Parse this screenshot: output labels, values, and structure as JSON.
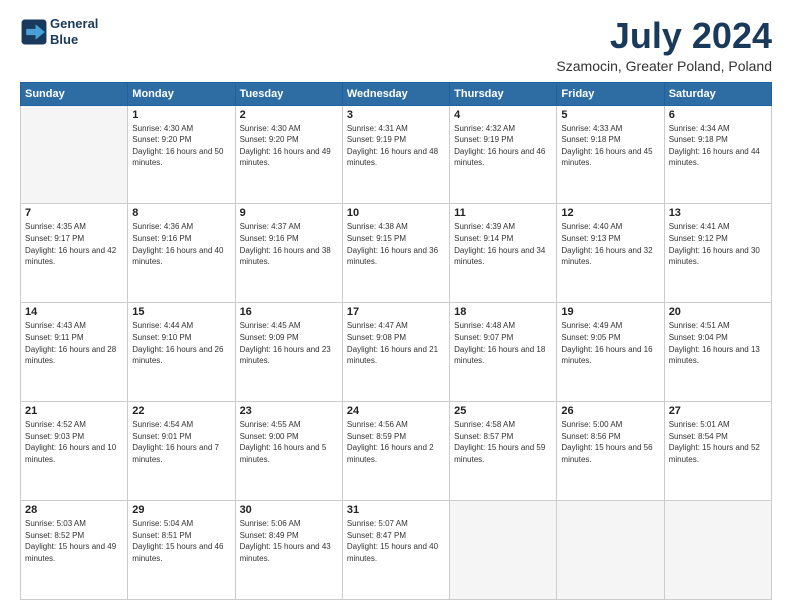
{
  "header": {
    "logo_line1": "General",
    "logo_line2": "Blue",
    "title": "July 2024",
    "location": "Szamocin, Greater Poland, Poland"
  },
  "weekdays": [
    "Sunday",
    "Monday",
    "Tuesday",
    "Wednesday",
    "Thursday",
    "Friday",
    "Saturday"
  ],
  "weeks": [
    [
      {
        "day": "",
        "empty": true
      },
      {
        "day": "1",
        "sunrise": "4:30 AM",
        "sunset": "9:20 PM",
        "daylight": "16 hours and 50 minutes."
      },
      {
        "day": "2",
        "sunrise": "4:30 AM",
        "sunset": "9:20 PM",
        "daylight": "16 hours and 49 minutes."
      },
      {
        "day": "3",
        "sunrise": "4:31 AM",
        "sunset": "9:19 PM",
        "daylight": "16 hours and 48 minutes."
      },
      {
        "day": "4",
        "sunrise": "4:32 AM",
        "sunset": "9:19 PM",
        "daylight": "16 hours and 46 minutes."
      },
      {
        "day": "5",
        "sunrise": "4:33 AM",
        "sunset": "9:18 PM",
        "daylight": "16 hours and 45 minutes."
      },
      {
        "day": "6",
        "sunrise": "4:34 AM",
        "sunset": "9:18 PM",
        "daylight": "16 hours and 44 minutes."
      }
    ],
    [
      {
        "day": "7",
        "sunrise": "4:35 AM",
        "sunset": "9:17 PM",
        "daylight": "16 hours and 42 minutes."
      },
      {
        "day": "8",
        "sunrise": "4:36 AM",
        "sunset": "9:16 PM",
        "daylight": "16 hours and 40 minutes."
      },
      {
        "day": "9",
        "sunrise": "4:37 AM",
        "sunset": "9:16 PM",
        "daylight": "16 hours and 38 minutes."
      },
      {
        "day": "10",
        "sunrise": "4:38 AM",
        "sunset": "9:15 PM",
        "daylight": "16 hours and 36 minutes."
      },
      {
        "day": "11",
        "sunrise": "4:39 AM",
        "sunset": "9:14 PM",
        "daylight": "16 hours and 34 minutes."
      },
      {
        "day": "12",
        "sunrise": "4:40 AM",
        "sunset": "9:13 PM",
        "daylight": "16 hours and 32 minutes."
      },
      {
        "day": "13",
        "sunrise": "4:41 AM",
        "sunset": "9:12 PM",
        "daylight": "16 hours and 30 minutes."
      }
    ],
    [
      {
        "day": "14",
        "sunrise": "4:43 AM",
        "sunset": "9:11 PM",
        "daylight": "16 hours and 28 minutes."
      },
      {
        "day": "15",
        "sunrise": "4:44 AM",
        "sunset": "9:10 PM",
        "daylight": "16 hours and 26 minutes."
      },
      {
        "day": "16",
        "sunrise": "4:45 AM",
        "sunset": "9:09 PM",
        "daylight": "16 hours and 23 minutes."
      },
      {
        "day": "17",
        "sunrise": "4:47 AM",
        "sunset": "9:08 PM",
        "daylight": "16 hours and 21 minutes."
      },
      {
        "day": "18",
        "sunrise": "4:48 AM",
        "sunset": "9:07 PM",
        "daylight": "16 hours and 18 minutes."
      },
      {
        "day": "19",
        "sunrise": "4:49 AM",
        "sunset": "9:05 PM",
        "daylight": "16 hours and 16 minutes."
      },
      {
        "day": "20",
        "sunrise": "4:51 AM",
        "sunset": "9:04 PM",
        "daylight": "16 hours and 13 minutes."
      }
    ],
    [
      {
        "day": "21",
        "sunrise": "4:52 AM",
        "sunset": "9:03 PM",
        "daylight": "16 hours and 10 minutes."
      },
      {
        "day": "22",
        "sunrise": "4:54 AM",
        "sunset": "9:01 PM",
        "daylight": "16 hours and 7 minutes."
      },
      {
        "day": "23",
        "sunrise": "4:55 AM",
        "sunset": "9:00 PM",
        "daylight": "16 hours and 5 minutes."
      },
      {
        "day": "24",
        "sunrise": "4:56 AM",
        "sunset": "8:59 PM",
        "daylight": "16 hours and 2 minutes."
      },
      {
        "day": "25",
        "sunrise": "4:58 AM",
        "sunset": "8:57 PM",
        "daylight": "15 hours and 59 minutes."
      },
      {
        "day": "26",
        "sunrise": "5:00 AM",
        "sunset": "8:56 PM",
        "daylight": "15 hours and 56 minutes."
      },
      {
        "day": "27",
        "sunrise": "5:01 AM",
        "sunset": "8:54 PM",
        "daylight": "15 hours and 52 minutes."
      }
    ],
    [
      {
        "day": "28",
        "sunrise": "5:03 AM",
        "sunset": "8:52 PM",
        "daylight": "15 hours and 49 minutes."
      },
      {
        "day": "29",
        "sunrise": "5:04 AM",
        "sunset": "8:51 PM",
        "daylight": "15 hours and 46 minutes."
      },
      {
        "day": "30",
        "sunrise": "5:06 AM",
        "sunset": "8:49 PM",
        "daylight": "15 hours and 43 minutes."
      },
      {
        "day": "31",
        "sunrise": "5:07 AM",
        "sunset": "8:47 PM",
        "daylight": "15 hours and 40 minutes."
      },
      {
        "day": "",
        "empty": true
      },
      {
        "day": "",
        "empty": true
      },
      {
        "day": "",
        "empty": true
      }
    ]
  ]
}
